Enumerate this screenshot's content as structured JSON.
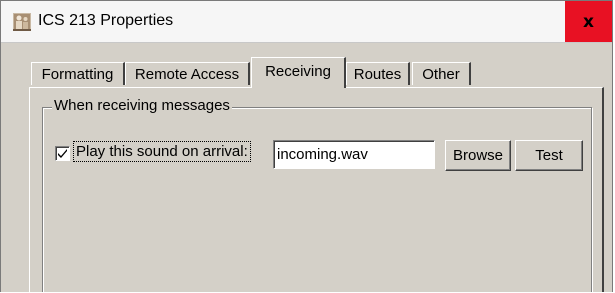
{
  "window": {
    "title": "ICS 213 Properties",
    "close_label": "x"
  },
  "tabs": [
    {
      "label": "Formatting",
      "active": false
    },
    {
      "label": "Remote Access",
      "active": false
    },
    {
      "label": "Receiving",
      "active": true
    },
    {
      "label": "Routes",
      "active": false
    },
    {
      "label": "Other",
      "active": false
    }
  ],
  "receiving": {
    "group_title": "When receiving messages",
    "play_sound_label": "Play this sound on arrival:",
    "play_sound_checked": true,
    "sound_file": "incoming.wav",
    "browse_label": "Browse",
    "test_label": "Test"
  },
  "colors": {
    "dialog_background": "#d4d0c8",
    "close_button": "#e81123",
    "titlebar": "#f6f6f6"
  },
  "icons": {
    "app": "ics-app-icon",
    "close": "close-icon",
    "check": "checkmark-icon"
  }
}
